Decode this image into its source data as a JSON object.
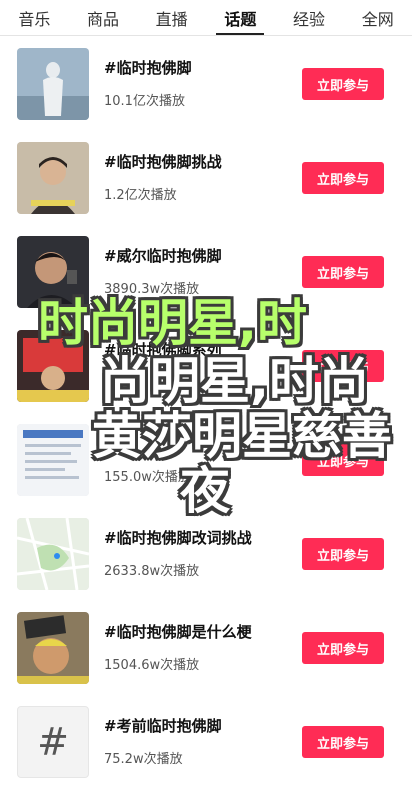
{
  "tabs": [
    {
      "label": "音乐"
    },
    {
      "label": "商品"
    },
    {
      "label": "直播"
    },
    {
      "label": "话题",
      "active": true
    },
    {
      "label": "经验"
    },
    {
      "label": "全网"
    }
  ],
  "topics": [
    {
      "title": "#临时抱佛脚",
      "meta": "10.1亿次播放",
      "button": "立即参与"
    },
    {
      "title": "#临时抱佛脚挑战",
      "meta": "1.2亿次播放",
      "button": "立即参与"
    },
    {
      "title": "#威尔临时抱佛脚",
      "meta": "3890.3w次播放",
      "button": "立即参与"
    },
    {
      "title": "#临时抱佛脚系列",
      "meta": "",
      "button": "立即参与"
    },
    {
      "title": "",
      "meta": "155.0w次播放",
      "button": "立即参与"
    },
    {
      "title": "#临时抱佛脚改词挑战",
      "meta": "2633.8w次播放",
      "button": "立即参与"
    },
    {
      "title": "#临时抱佛脚是什么梗",
      "meta": "1504.6w次播放",
      "button": "立即参与"
    },
    {
      "title": "#考前临时抱佛脚",
      "meta": "75.2w次播放",
      "button": "立即参与"
    }
  ],
  "overlay": {
    "line1": "时尚明星,时",
    "line2": "尚明星,时尚",
    "line3": "黄莎明星慈善",
    "line4": "夜"
  },
  "colors": {
    "accent": "#ff2c55",
    "overlay_highlight": "#b7ff6b"
  }
}
